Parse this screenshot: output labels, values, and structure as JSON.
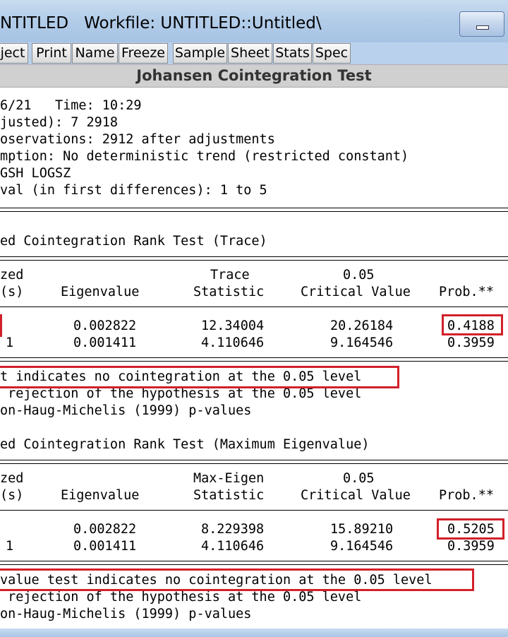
{
  "window": {
    "title": "NTITLED   Workfile: UNTITLED::Untitled\\"
  },
  "toolbar": {
    "buttons": [
      "ject",
      "Print",
      "Name",
      "Freeze",
      "Sample",
      "Sheet",
      "Stats",
      "Spec"
    ]
  },
  "header": {
    "title": "Johansen Cointegration Test"
  },
  "info": {
    "line1": "6/21   Time: 10:29",
    "line2": "justed): 7 2918",
    "line3": "oservations: 2912 after adjustments",
    "line4": "mption: No deterministic trend (restricted constant)",
    "line5": "GSH LOGSZ",
    "line6": "val (in first differences): 1 to 5"
  },
  "trace": {
    "title": "ed Cointegration Rank Test (Trace)",
    "hdr1": {
      "c0": "zed",
      "c2": "Trace",
      "c3": "0.05"
    },
    "hdr2": {
      "c0": "(s)",
      "c1": "Eigenvalue",
      "c2": "Statistic",
      "c3": "Critical Value",
      "c4": "Prob.**"
    },
    "rows": [
      {
        "c0": "",
        "eig": "0.002822",
        "stat": "12.34004",
        "cv": "20.26184",
        "prob": "0.4188"
      },
      {
        "c0": "1",
        "eig": "0.001411",
        "stat": "4.110646",
        "cv": "9.164546",
        "prob": "0.3959"
      }
    ],
    "note1": "t indicates no cointegration at the 0.05 level",
    "note2": " rejection of the hypothesis at the 0.05 level",
    "note3": "on-Haug-Michelis (1999) p-values"
  },
  "maxeig": {
    "title": "ed Cointegration Rank Test (Maximum Eigenvalue)",
    "hdr1": {
      "c0": "zed",
      "c2": "Max-Eigen",
      "c3": "0.05"
    },
    "hdr2": {
      "c0": "(s)",
      "c1": "Eigenvalue",
      "c2": "Statistic",
      "c3": "Critical Value",
      "c4": "Prob.**"
    },
    "rows": [
      {
        "c0": "",
        "eig": "0.002822",
        "stat": "8.229398",
        "cv": "15.89210",
        "prob": "0.5205"
      },
      {
        "c0": "1",
        "eig": "0.001411",
        "stat": "4.110646",
        "cv": "9.164546",
        "prob": "0.3959"
      }
    ],
    "note1": "value test indicates no cointegration at the 0.05 level",
    "note2": " rejection of the hypothesis at the 0.05 level",
    "note3": "on-Haug-Michelis (1999) p-values"
  },
  "colors": {
    "highlight": "#d2202a",
    "titlebar": "#b3cde9",
    "header_bg": "#d0d0d0"
  }
}
